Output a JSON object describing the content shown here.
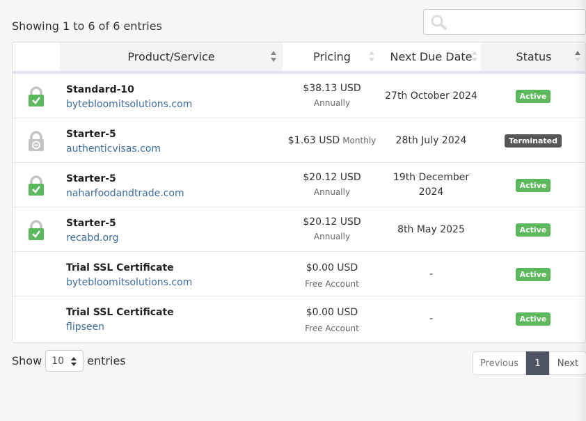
{
  "info_text": "Showing 1 to 6 of 6 entries",
  "search": {
    "placeholder": "",
    "value": "",
    "icon": "search-icon"
  },
  "columns": [
    "Product/Service",
    "Pricing",
    "Next Due Date",
    "Status"
  ],
  "rows": [
    {
      "lock": "locked",
      "product": "Standard-10",
      "domain": "bytebloomitsolutions.com",
      "amount": "$38.13 USD",
      "cycle": "Annually",
      "due": "27th October 2024",
      "status": "Active",
      "status_type": "active"
    },
    {
      "lock": "inactive",
      "product": "Starter-5",
      "domain": "authenticvisas.com",
      "amount": "$1.63 USD",
      "cycle": "Monthly",
      "due": "28th July 2024",
      "status": "Terminated",
      "status_type": "terminated"
    },
    {
      "lock": "locked",
      "product": "Starter-5",
      "domain": "naharfoodandtrade.com",
      "amount": "$20.12 USD",
      "cycle": "Annually",
      "due": "19th December 2024",
      "status": "Active",
      "status_type": "active"
    },
    {
      "lock": "locked",
      "product": "Starter-5",
      "domain": "recabd.org",
      "amount": "$20.12 USD",
      "cycle": "Annually",
      "due": "8th May 2025",
      "status": "Active",
      "status_type": "active"
    },
    {
      "lock": "none",
      "product": "Trial SSL Certificate",
      "domain": "bytebloomitsolutions.com",
      "amount": "$0.00 USD",
      "cycle": "Free Account",
      "due": "-",
      "status": "Active",
      "status_type": "active"
    },
    {
      "lock": "none",
      "product": "Trial SSL Certificate",
      "domain": "flipseen",
      "amount": "$0.00 USD",
      "cycle": "Free Account",
      "due": "-",
      "status": "Active",
      "status_type": "active"
    }
  ],
  "length": {
    "show_label": "Show",
    "selected": "10",
    "entries_label": "entries"
  },
  "pagination": {
    "previous": "Previous",
    "current": "1",
    "next": "Next"
  },
  "colors": {
    "active": "#5cb85c",
    "terminated": "#555555",
    "link": "#3e6b9a",
    "lock_green": "#5cb85c",
    "lock_grey": "#c4c4c4",
    "current_page": "#505563"
  }
}
